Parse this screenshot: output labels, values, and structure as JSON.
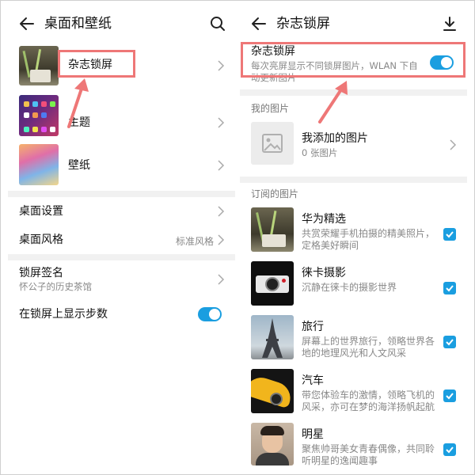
{
  "colors": {
    "accent": "#1a9ee0",
    "annotation": "#ee7777"
  },
  "left": {
    "header": {
      "title": "桌面和壁纸",
      "back_icon": "back-arrow-icon",
      "action_icon": "search-icon"
    },
    "items": [
      {
        "label": "杂志锁屏",
        "thumb": "magazine-lock-thumb"
      },
      {
        "label": "主题",
        "thumb": "theme-thumb"
      },
      {
        "label": "壁纸",
        "thumb": "wallpaper-thumb"
      }
    ],
    "desktop_settings": "桌面设置",
    "desktop_style": {
      "label": "桌面风格",
      "value": "标准风格"
    },
    "signature": {
      "label": "锁屏签名",
      "value": "怀公子的历史茶馆"
    },
    "show_steps": {
      "label": "在锁屏上显示步数",
      "on": true
    }
  },
  "right": {
    "header": {
      "title": "杂志锁屏",
      "back_icon": "back-arrow-icon",
      "action_icon": "download-icon"
    },
    "toggle_row": {
      "title": "杂志锁屏",
      "desc": "每次亮屏显示不同锁屏图片，WLAN 下自动更新图片",
      "on": true
    },
    "my_pictures": {
      "section": "我的图片",
      "title": "我添加的图片",
      "count": "0 张图片"
    },
    "subscribed": {
      "section": "订阅的图片",
      "items": [
        {
          "title": "华为精选",
          "desc": "共赏荣耀手机拍摄的精美照片，定格美好瞬间",
          "checked": true
        },
        {
          "title": "徕卡摄影",
          "desc": "沉静在徕卡的摄影世界",
          "checked": true
        },
        {
          "title": "旅行",
          "desc": "屏幕上的世界旅行，领略世界各地的地理风光和人文风采",
          "checked": true
        },
        {
          "title": "汽车",
          "desc": "带您体验车的激情，领略飞机的风采，亦可在梦的海洋扬帆起航",
          "checked": true
        },
        {
          "title": "明星",
          "desc": "聚焦帅哥美女青春偶像，共同聆听明星的逸闻趣事",
          "checked": true
        }
      ]
    }
  }
}
